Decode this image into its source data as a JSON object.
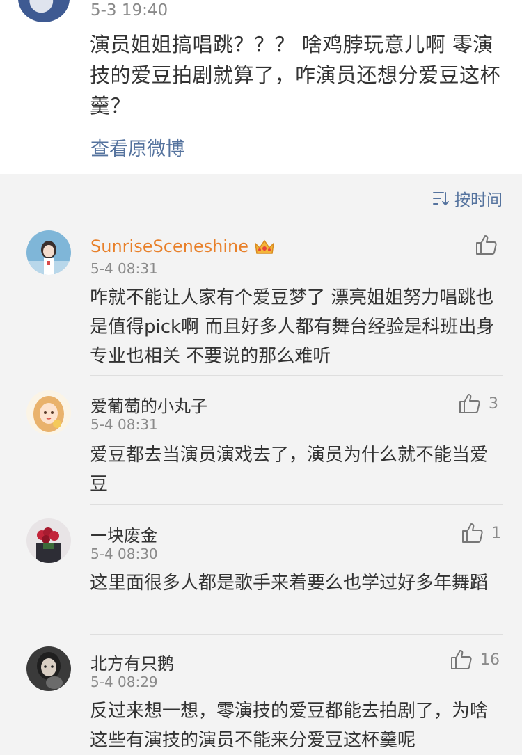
{
  "post": {
    "time": "5-3 19:40",
    "text": "演员姐姐搞唱跳？？？ 啥鸡脖玩意儿啊  零演技的爱豆拍剧就算了，咋演员还想分爱豆这杯羹？",
    "view_original": "查看原微博"
  },
  "sort": {
    "label": "按时间",
    "icon": "sort-icon"
  },
  "comments": [
    {
      "username": "SunriseSceneshine",
      "badge": "crown-icon",
      "time": "5-4 08:31",
      "text": "咋就不能让人家有个爱豆梦了  漂亮姐姐努力唱跳也是值得pick啊 而且好多人都有舞台经验是科班出身专业也相关 不要说的那么难听",
      "likes": ""
    },
    {
      "username": "爱葡萄的小丸子",
      "time": "5-4 08:31",
      "text": "爱豆都去当演员演戏去了，演员为什么就不能当爱豆",
      "likes": "3"
    },
    {
      "username": "一块废金",
      "time": "5-4 08:30",
      "text": "这里面很多人都是歌手来着要么也学过好多年舞蹈",
      "likes": "1"
    },
    {
      "username": "北方有只鹅",
      "time": "5-4 08:29",
      "text": "反过来想一想，零演技的爱豆都能去拍剧了，为啥这些有演技的演员不能来分爱豆这杯羹呢",
      "likes": "16"
    }
  ],
  "colors": {
    "link": "#55739e",
    "vip_name": "#e8802a",
    "muted": "#8a8a8a",
    "text": "#333333"
  }
}
